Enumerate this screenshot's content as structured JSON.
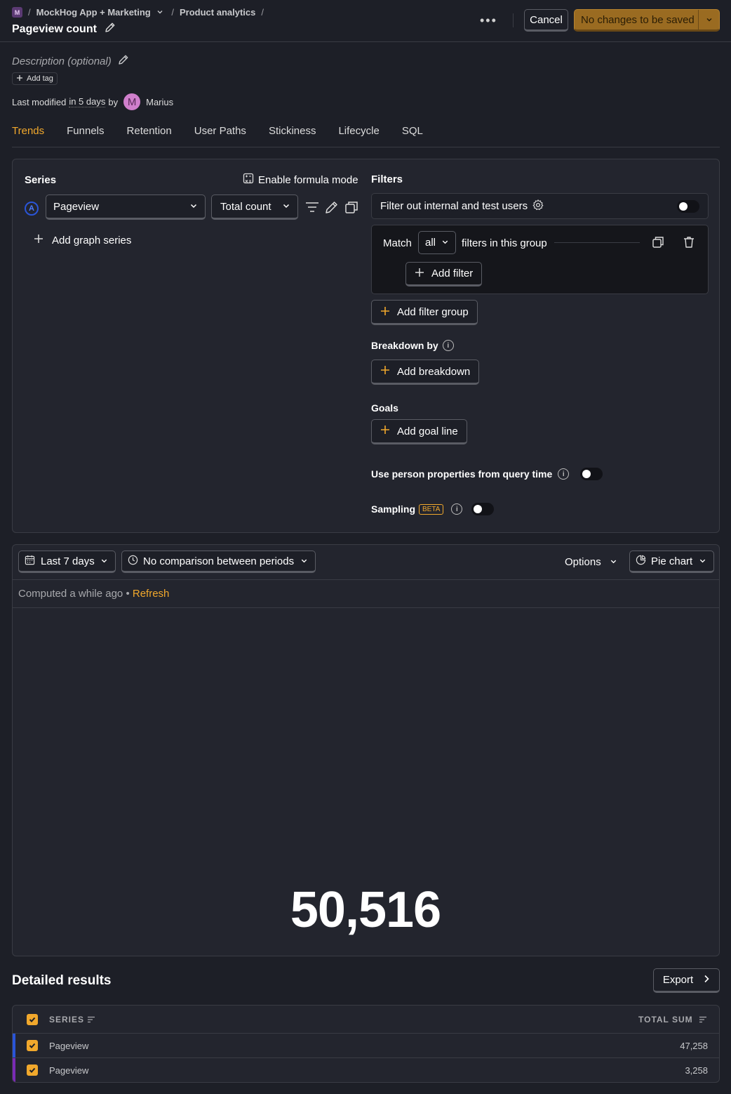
{
  "header": {
    "project_initial": "M",
    "project": "MockHog App + Marketing",
    "section": "Product analytics",
    "title": "Pageview count",
    "cancel_label": "Cancel",
    "save_label": "No changes to be saved"
  },
  "meta": {
    "description_placeholder": "Description (optional)",
    "add_tag": "Add tag",
    "modified_prefix": "Last modified",
    "modified_when": "in 5 days",
    "modified_by": "by",
    "user_initial": "M",
    "user": "Marius"
  },
  "tabs": [
    "Trends",
    "Funnels",
    "Retention",
    "User Paths",
    "Stickiness",
    "Lifecycle",
    "SQL"
  ],
  "series": {
    "title": "Series",
    "formula_label": "Enable formula mode",
    "badge": "A",
    "event": "Pageview",
    "aggregation": "Total count",
    "add_label": "Add graph series"
  },
  "filters": {
    "title": "Filters",
    "internal_label": "Filter out internal and test users",
    "match": "Match",
    "match_value": "all",
    "match_suffix": "filters in this group",
    "add_filter": "Add filter",
    "add_group": "Add filter group"
  },
  "breakdown": {
    "title": "Breakdown by",
    "add_label": "Add breakdown"
  },
  "goals": {
    "title": "Goals",
    "add_label": "Add goal line"
  },
  "person_props": {
    "label": "Use person properties from query time"
  },
  "sampling": {
    "label": "Sampling",
    "badge": "BETA"
  },
  "results": {
    "date_range": "Last 7 days",
    "comparison": "No comparison between periods",
    "options": "Options",
    "chart_type": "Pie chart",
    "computed": "Computed a while ago",
    "bullet": "•",
    "refresh": "Refresh",
    "big_number": "50,516"
  },
  "detailed": {
    "title": "Detailed results",
    "export": "Export",
    "col_series": "SERIES",
    "col_total": "TOTAL SUM",
    "rows": [
      {
        "name": "Pageview",
        "total": "47,258",
        "color": "#2a55d8"
      },
      {
        "name": "Pageview",
        "total": "3,258",
        "color": "#7a2bb5"
      }
    ]
  },
  "colors": {
    "accent": "#f1a82c",
    "save_bg": "#9a6b21"
  }
}
